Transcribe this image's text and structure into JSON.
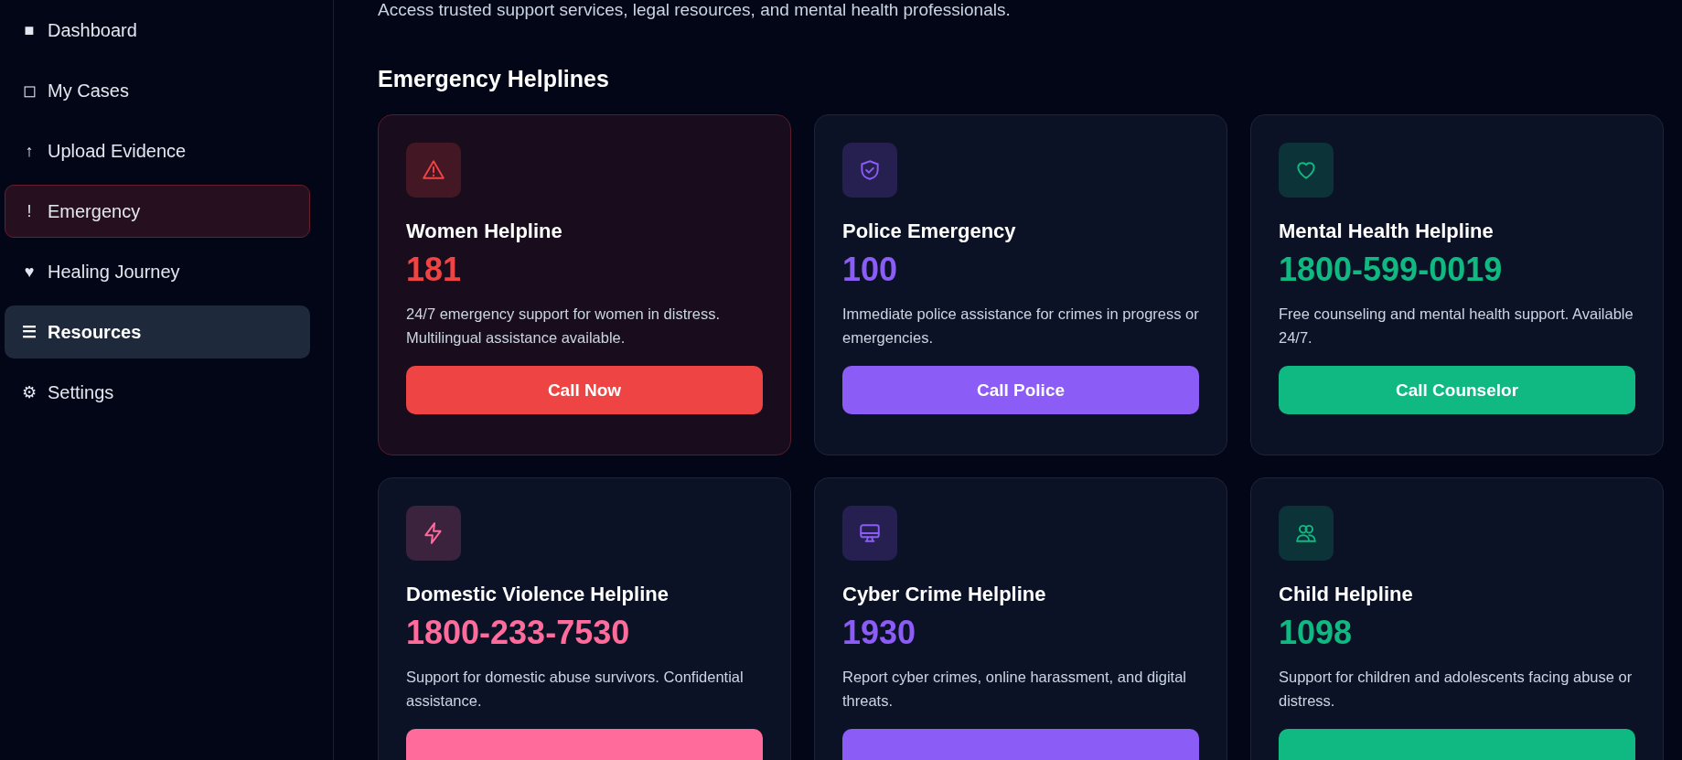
{
  "sidebar": {
    "items": [
      {
        "icon": "■",
        "label": "Dashboard",
        "selected": false,
        "alert": false
      },
      {
        "icon": "◻",
        "label": "My Cases",
        "selected": false,
        "alert": false
      },
      {
        "icon": "↑",
        "label": "Upload Evidence",
        "selected": false,
        "alert": false
      },
      {
        "icon": "!",
        "label": "Emergency",
        "selected": false,
        "alert": true
      },
      {
        "icon": "♥",
        "label": "Healing Journey",
        "selected": false,
        "alert": false
      },
      {
        "icon": "☰",
        "label": "Resources",
        "selected": true,
        "alert": false
      },
      {
        "icon": "⚙",
        "label": "Settings",
        "selected": false,
        "alert": false
      }
    ]
  },
  "subtitle": "Access trusted support services, legal resources, and mental health professionals.",
  "section_title": "Emergency Helplines",
  "helplines": [
    {
      "title": "Women Helpline",
      "number": "181",
      "description": "24/7 emergency support for women in distress. Multilingual assistance available.",
      "button": "Call Now",
      "color": "#ef4444",
      "highlighted": true
    },
    {
      "title": "Police Emergency",
      "number": "100",
      "description": "Immediate police assistance for crimes in progress or emergencies.",
      "button": "Call Police",
      "color": "#8b5cf6",
      "highlighted": false
    },
    {
      "title": "Mental Health Helpline",
      "number": "1800-599-0019",
      "description": "Free counseling and mental health support. Available 24/7.",
      "button": "Call Counselor",
      "color": "#10b981",
      "highlighted": false
    },
    {
      "title": "Domestic Violence Helpline",
      "number": "1800-233-7530",
      "description": "Support for domestic abuse survivors. Confidential assistance.",
      "color": "#ff6b9a",
      "highlighted": false
    },
    {
      "title": "Cyber Crime Helpline",
      "number": "1930",
      "description": "Report cyber crimes, online harassment, and digital threats.",
      "color": "#8b5cf6",
      "highlighted": false
    },
    {
      "title": "Child Helpline",
      "number": "1098",
      "description": "Support for children and adolescents facing abuse or distress.",
      "color": "#10b981",
      "highlighted": false
    }
  ]
}
